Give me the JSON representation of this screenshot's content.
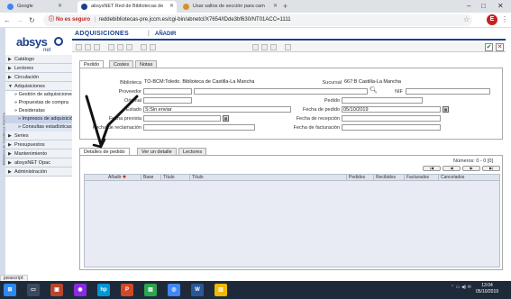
{
  "browser": {
    "tabs": [
      {
        "title": "Google",
        "active": false,
        "favicon_color": "#4285f4"
      },
      {
        "title": "absysNET Red de Bibliotecas de",
        "active": true,
        "favicon_color": "#1b3f8b"
      },
      {
        "title": "Usar saltos de sección para cam",
        "active": false,
        "favicon_color": "#d8902b"
      }
    ],
    "new_tab": "+",
    "address": {
      "security_label": "No es seguro",
      "url": "reddebibliotecas-pre.jccm.es/cgi-bin/abnetcl/X7654/IDde3bf630/NT01ACC=1111"
    },
    "avatar_letter": "E",
    "window_controls": [
      "–",
      "□",
      "✕"
    ]
  },
  "app": {
    "logo_text": "absys",
    "logo_sub": "net",
    "module_title": "ADQUISICIONES",
    "action_title": "AÑADIR",
    "vertical_strip_text": "Biblioteca de Castilla-La Mancha"
  },
  "sidebar": {
    "items": [
      {
        "label": "Catálogo",
        "type": "section"
      },
      {
        "label": "Lectores",
        "type": "section"
      },
      {
        "label": "Circulación",
        "type": "section"
      },
      {
        "label": "Adquisiciones",
        "type": "section-open"
      },
      {
        "label": "» Gestión de adquisiciones",
        "type": "sub"
      },
      {
        "label": "» Propuestas de compra",
        "type": "sub"
      },
      {
        "label": "» Desideratas",
        "type": "sub"
      },
      {
        "label": "» Impresos de adquisición",
        "type": "sub-deep-sel"
      },
      {
        "label": "» Consultas estadísticas",
        "type": "sub-deep"
      },
      {
        "label": "Series",
        "type": "section"
      },
      {
        "label": "Presupuestos",
        "type": "section"
      },
      {
        "label": "Mantenimiento",
        "type": "section"
      },
      {
        "label": "absysNET Opac",
        "type": "section"
      },
      {
        "label": "Administración",
        "type": "section"
      }
    ]
  },
  "form": {
    "tabs": [
      "Pedido",
      "Costes",
      "Notas"
    ],
    "fields": {
      "biblioteca_label": "Biblioteca",
      "biblioteca_value": "TO-BCM:Toledo. Biblioteca de Castilla-La Mancha",
      "sucursal_label": "Sucursal",
      "sucursal_value": "667:B Castilla-La Mancha",
      "proveedor_label": "Proveedor",
      "nif_label": "NIF",
      "original_label": "Original",
      "pedido_label": "Pedido",
      "estado_label": "Estado",
      "estado_value": "S:Sin enviar",
      "fecha_pedido_label": "Fecha de pedido",
      "fecha_pedido_value": "05/10/2019",
      "fecha_prevista_label": "Fecha prevista",
      "fecha_recepcion_label": "Fecha de recepción",
      "fecha_reclamacion_label": "Fecha de reclamación",
      "fecha_facturacion_label": "Fecha de facturación"
    }
  },
  "detail": {
    "tabs": [
      "Detalles de pedido",
      "Ver un detalle",
      "Lectores"
    ],
    "numeros": "Números: 0 - 0 [0]",
    "grid_columns": [
      "Añadir",
      "Base",
      "Título",
      "Título",
      "Pedidos",
      "Recibidos",
      "Facturados",
      "Cancelados"
    ]
  },
  "status_bar": "javascript:",
  "taskbar": {
    "clock_time": "13:04",
    "clock_date": "05/10/2019",
    "apps": [
      {
        "name": "windows",
        "color": "#2d89ef",
        "label": "⊞"
      },
      {
        "name": "task-view",
        "color": "#3a4a5e",
        "label": "▭"
      },
      {
        "name": "presentation",
        "color": "#b7472a",
        "label": "▣"
      },
      {
        "name": "media",
        "color": "#8a2be2",
        "label": "◉"
      },
      {
        "name": "hp",
        "color": "#0096d6",
        "label": "hp"
      },
      {
        "name": "powerpoint",
        "color": "#d24726",
        "label": "P"
      },
      {
        "name": "files",
        "color": "#2ea44f",
        "label": "▤"
      },
      {
        "name": "chrome",
        "color": "#4285f4",
        "label": "◎"
      },
      {
        "name": "word",
        "color": "#2b579a",
        "label": "W"
      },
      {
        "name": "explorer",
        "color": "#f2b807",
        "label": "▥"
      }
    ]
  }
}
